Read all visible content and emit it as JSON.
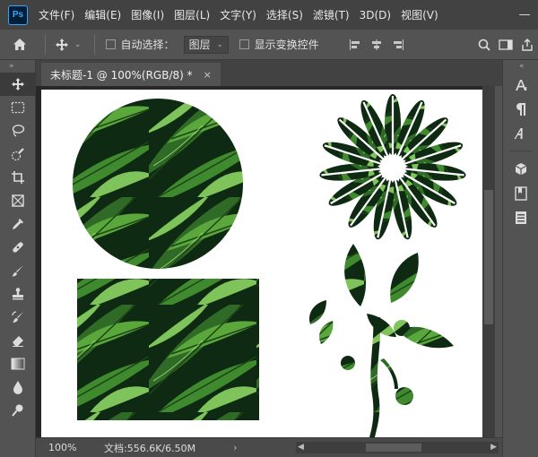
{
  "app": {
    "logo": "Ps"
  },
  "menu": [
    "文件(F)",
    "编辑(E)",
    "图像(I)",
    "图层(L)",
    "文字(Y)",
    "选择(S)",
    "滤镜(T)",
    "3D(D)",
    "视图(V)"
  ],
  "window_controls": {
    "minimize": "—",
    "maximize": "☐",
    "close": "✕"
  },
  "options": {
    "auto_select_label": "自动选择：",
    "auto_select_checked": false,
    "target_value": "图层",
    "show_transform_label": "显示变换控件",
    "show_transform_checked": false
  },
  "document_tab": {
    "title": "未标题-1 @ 100%(RGB/8) *",
    "close": "×"
  },
  "status": {
    "zoom": "100%",
    "doc_size": "文档:556.6K/6.50M",
    "arrow": "›"
  },
  "tools": [
    "move-tool",
    "marquee-tool",
    "lasso-tool",
    "quick-selection-tool",
    "crop-tool",
    "frame-tool",
    "eyedropper-tool",
    "healing-brush-tool",
    "brush-tool",
    "clone-stamp-tool",
    "history-brush-tool",
    "eraser-tool",
    "gradient-tool",
    "blur-tool",
    "dodge-tool"
  ],
  "colors": {
    "menubar": "#424242",
    "workspace": "#535353",
    "pasteboard": "#282828",
    "canvas": "#ffffff",
    "leaf_dark": "#0f2a12",
    "leaf_mid": "#2f6b26",
    "leaf_light": "#7fc45a"
  }
}
